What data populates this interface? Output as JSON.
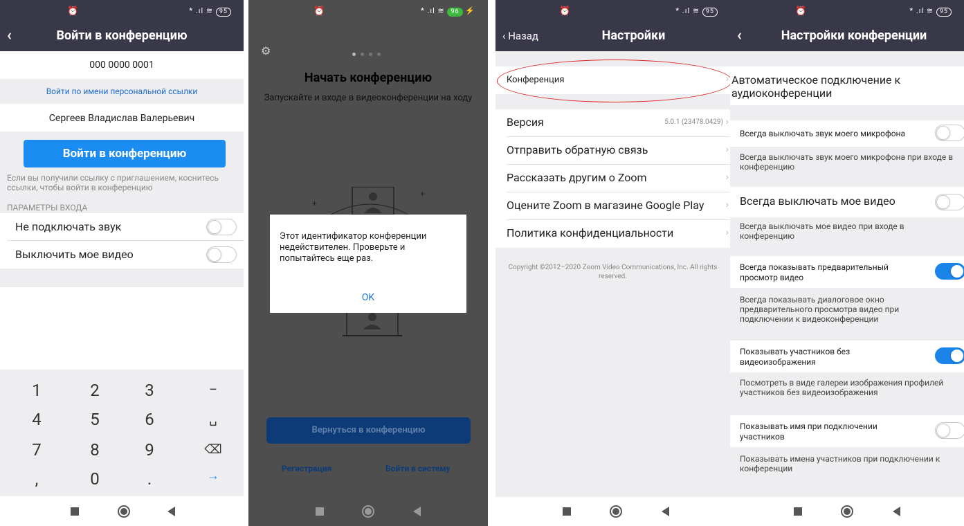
{
  "status": {
    "alarm_icon": "alarm-clock-icon",
    "signal_text": "* .ıl ≋",
    "battery_s1": "95",
    "battery_s2": "96",
    "battery_s3": "95",
    "battery_s4": "95"
  },
  "screen1": {
    "title": "Войти в конференцию",
    "meeting_id": "000 0000 0001",
    "personal_link": "Войти по имени персональной ссылки",
    "name": "Сергеев Владислав Валерьевич",
    "join_button": "Войти в конференцию",
    "hint": "Если вы получили ссылку с приглашением, коснитесь ссылки, чтобы войти в конференцию",
    "params_header": "ПАРАМЕТРЫ ВХОДА",
    "option_audio": "Не подключать звук",
    "option_video": "Выключить мое видео",
    "keys": [
      "1",
      "2",
      "3",
      "–",
      "4",
      "5",
      "6",
      "␣",
      "7",
      "8",
      "9",
      "⌫",
      ",",
      "0",
      ".",
      "→"
    ]
  },
  "screen2": {
    "title": "Начать конференцию",
    "subtitle": "Запускайте и входе в видеоконференции на ходу",
    "dialog_message": "Этот идентификатор конференции недействителен. Проверьте и попытайтесь еще раз.",
    "dialog_ok": "OK",
    "return_button": "Вернуться в конференцию",
    "register": "Регистрация",
    "login": "Войти в систему"
  },
  "screen3": {
    "back": "Назад",
    "title": "Настройки",
    "conference": "Конференция",
    "version_label": "Версия",
    "version_value": "5.0.1 (23478.0429)",
    "feedback": "Отправить обратную связь",
    "tell_others": "Рассказать другим о Zoom",
    "rate": "Оцените Zoom в магазине Google Play",
    "privacy": "Политика конфиденциальности",
    "copyright": "Copyright ©2012–2020 Zoom Video Communications, Inc. All rights reserved."
  },
  "screen4": {
    "title": "Настройки конференции",
    "auto_audio": "Автоматическое подключение к аудиоконференции",
    "mute_mic_label": "Всегда выключать звук моего микрофона",
    "mute_mic_desc": "Всегда выключать звук моего микрофона при входе в конференцию",
    "video_off_label": "Всегда выключать мое видео",
    "video_off_desc": "Всегда выключать мое видео при входе в конференцию",
    "preview_label": "Всегда показывать предварительный просмотр видео",
    "preview_desc": "Всегда показывать диалоговое окно предварительного просмотра видео при подключении к видеоконференции",
    "no_video_label": "Показывать участников без видеоизображения",
    "no_video_desc": "Посмотреть в виде галереи изображения профилей участников без видеоизображения",
    "show_names_label": "Показывать имя при подключении участников",
    "show_names_desc": "Показывать имена участников при подключении к конференции"
  },
  "toggles": {
    "s1_audio": false,
    "s1_video": false,
    "s4_mute_mic": false,
    "s4_video_off": false,
    "s4_preview": true,
    "s4_no_video": true,
    "s4_show_names": false
  }
}
